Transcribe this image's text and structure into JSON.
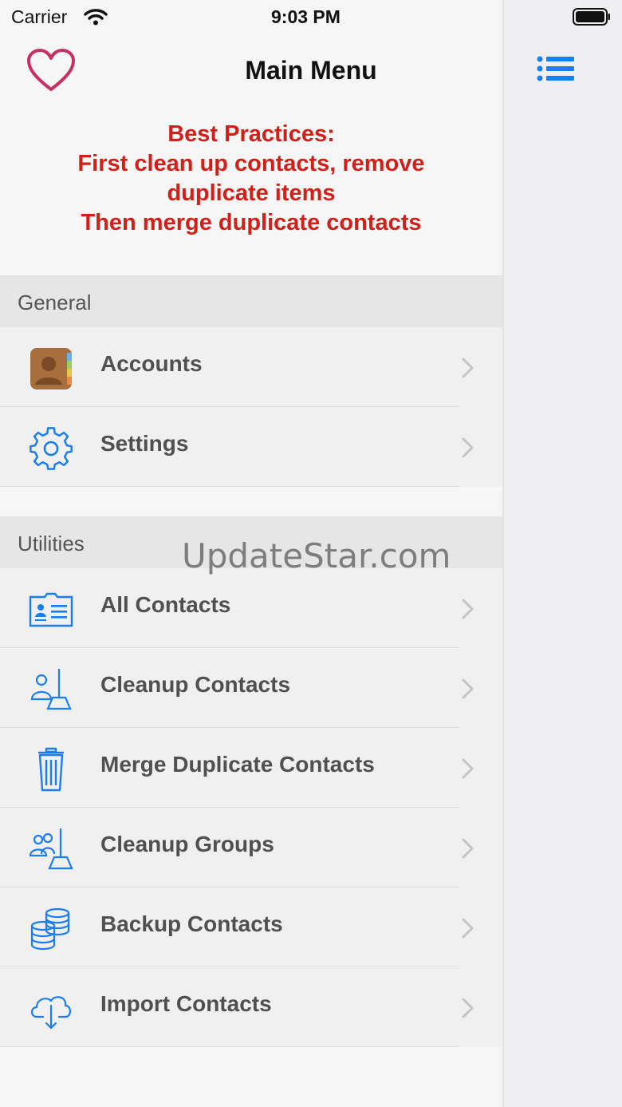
{
  "status_bar": {
    "carrier": "Carrier",
    "time": "9:03 PM"
  },
  "nav": {
    "title": "Main Menu",
    "left_icon": "heart-icon",
    "right_icon": "list-icon"
  },
  "notice": {
    "lines": [
      "Best Practices:",
      "First clean up contacts, remove",
      "duplicate items",
      "Then merge duplicate contacts"
    ],
    "color": "#d0201a"
  },
  "sections": [
    {
      "title": "General",
      "items": [
        {
          "label": "Accounts",
          "icon": "contacts-book-icon"
        },
        {
          "label": "Settings",
          "icon": "gear-icon"
        }
      ]
    },
    {
      "title": "Utilities",
      "items": [
        {
          "label": "All Contacts",
          "icon": "contact-card-icon"
        },
        {
          "label": "Cleanup Contacts",
          "icon": "person-broom-icon"
        },
        {
          "label": "Merge Duplicate Contacts",
          "icon": "trash-icon"
        },
        {
          "label": "Cleanup Groups",
          "icon": "group-broom-icon"
        },
        {
          "label": "Backup Contacts",
          "icon": "database-icon"
        },
        {
          "label": "Import Contacts",
          "icon": "cloud-download-icon"
        }
      ]
    }
  ],
  "watermark": "UpdateStar.com",
  "accent_color": "#1a7ef2"
}
